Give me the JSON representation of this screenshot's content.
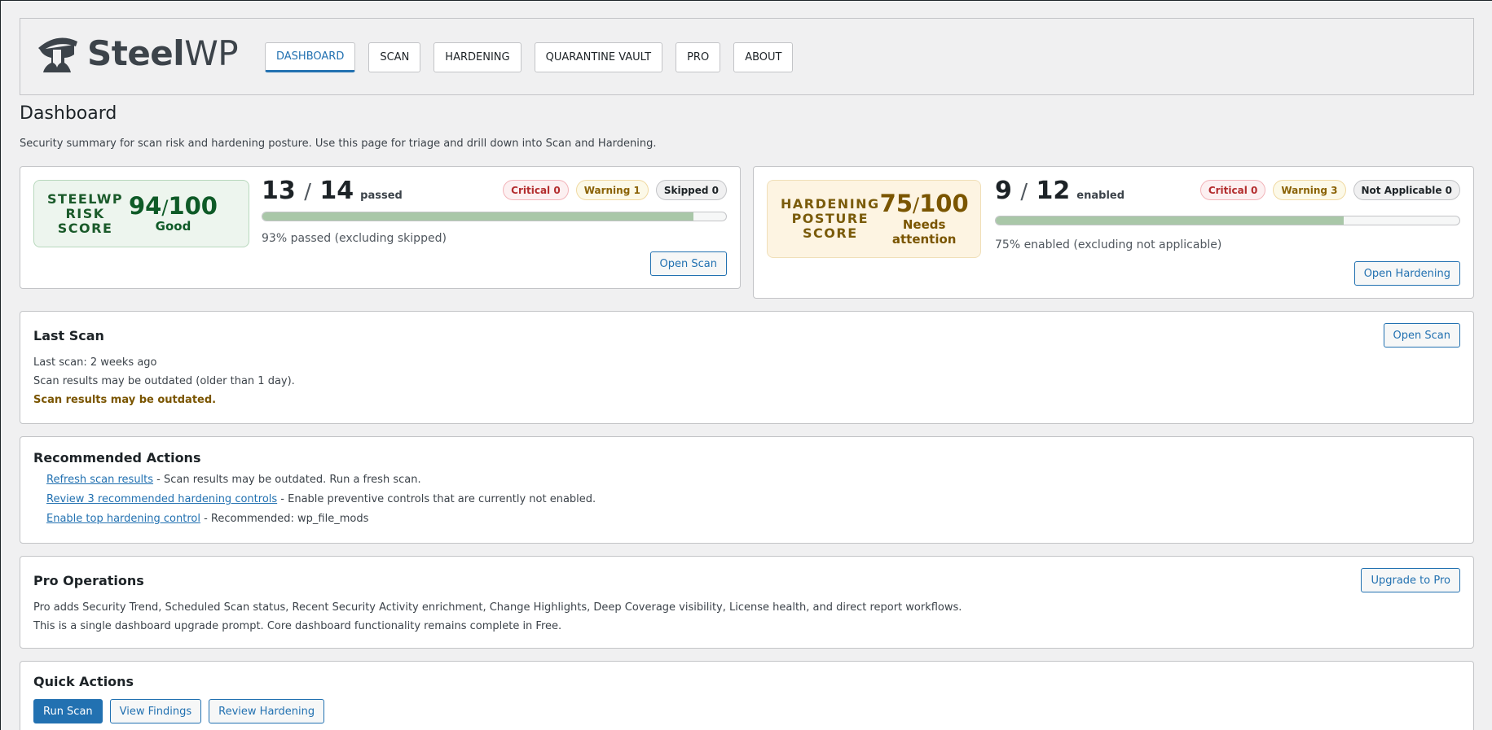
{
  "header": {
    "logo_bold": "Steel",
    "logo_light": "WP",
    "nav": [
      {
        "label": "Dashboard"
      },
      {
        "label": "Scan"
      },
      {
        "label": "Hardening"
      },
      {
        "label": "Quarantine Vault"
      },
      {
        "label": "Pro"
      },
      {
        "label": "About"
      }
    ]
  },
  "page": {
    "title": "Dashboard",
    "description": "Security summary for scan risk and hardening posture. Use this page for triage and drill down into Scan and Hardening."
  },
  "risk": {
    "label_lines": [
      "SteelWP",
      "Risk",
      "Score"
    ],
    "score": "94",
    "max": "100",
    "status": "Good",
    "count": "13",
    "total": "14",
    "count_word": "passed",
    "badges": [
      "Critical 0",
      "Warning 1",
      "Skipped 0"
    ],
    "progress": 0.93,
    "note": "93% passed (excluding skipped)",
    "button": "Open Scan"
  },
  "hardening": {
    "label_lines": [
      "Hardening",
      "Posture",
      "Score"
    ],
    "score": "75",
    "max": "100",
    "status_lines": [
      "Needs",
      "attention"
    ],
    "count": "9",
    "total": "12",
    "count_word": "enabled",
    "badges": [
      "Critical 0",
      "Warning 3",
      "Not Applicable 0"
    ],
    "progress": 0.75,
    "note": "75% enabled (excluding not applicable)",
    "button": "Open Hardening"
  },
  "last_scan": {
    "title": "Last Scan",
    "button": "Open Scan",
    "lines": [
      "Last scan: 2 weeks ago",
      "Scan results may be outdated (older than 1 day)."
    ],
    "warning": "Scan results may be outdated."
  },
  "recommended": {
    "title": "Recommended Actions",
    "items": [
      {
        "link": "Refresh scan results",
        "text": " - Scan results may be outdated. Run a fresh scan."
      },
      {
        "link": "Review 3 recommended hardening controls",
        "text": " - Enable preventive controls that are currently not enabled."
      },
      {
        "link": "Enable top hardening control",
        "text": " - Recommended: wp_file_mods"
      }
    ]
  },
  "pro": {
    "title": "Pro Operations",
    "button": "Upgrade to Pro",
    "lines": [
      "Pro adds Security Trend, Scheduled Scan status, Recent Security Activity enrichment, Change Highlights, Deep Coverage visibility, License health, and direct report workflows.",
      "This is a single dashboard upgrade prompt. Core dashboard functionality remains complete in Free."
    ]
  },
  "quick": {
    "title": "Quick Actions",
    "buttons": [
      "Run Scan",
      "View Findings",
      "Review Hardening"
    ]
  },
  "colors": {
    "accent": "#2271b1",
    "good": "#0e5a27",
    "warning": "#7a5500",
    "critical": "#b32d2e"
  }
}
